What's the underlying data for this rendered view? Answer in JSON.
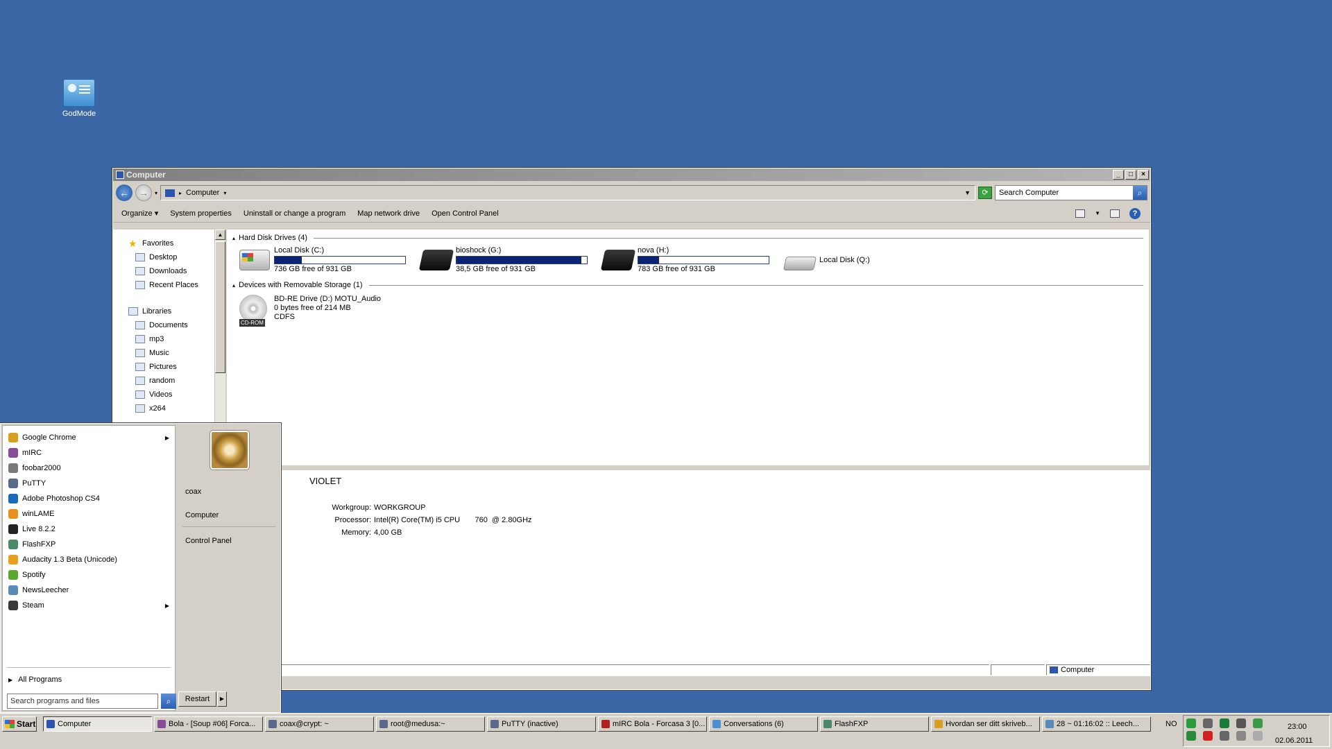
{
  "desktop": {
    "icons": [
      {
        "label": "GodMode"
      }
    ]
  },
  "window": {
    "title": "Computer",
    "address": "Computer",
    "search_placeholder": "Search Computer",
    "commands": [
      "Organize",
      "System properties",
      "Uninstall or change a program",
      "Map network drive",
      "Open Control Panel"
    ],
    "nav": {
      "favorites": {
        "label": "Favorites",
        "items": [
          "Desktop",
          "Downloads",
          "Recent Places"
        ]
      },
      "libraries": {
        "label": "Libraries",
        "items": [
          "Documents",
          "mp3",
          "Music",
          "Pictures",
          "random",
          "Videos",
          "x264"
        ]
      }
    },
    "hdd_section": "Hard Disk Drives (4)",
    "drives": [
      {
        "name": "Local Disk (C:)",
        "free": "736 GB free of 931 GB",
        "used_fraction": 0.21,
        "icon": "windows-drive-icon"
      },
      {
        "name": "bioshock (G:)",
        "free": "38,5 GB free of 931 GB",
        "used_fraction": 0.96,
        "icon": "external-drive-icon"
      },
      {
        "name": "nova (H:)",
        "free": "783 GB free of 931 GB",
        "used_fraction": 0.16,
        "icon": "external-drive-icon"
      },
      {
        "name": "Local Disk (Q:)",
        "icon": "disk-drive-icon"
      }
    ],
    "removable_section": "Devices with Removable Storage (1)",
    "removable": {
      "name": "BD-RE Drive (D:) MOTU_Audio",
      "free": "0 bytes free of 214 MB",
      "fs": "CDFS",
      "badge": "CD-ROM"
    },
    "details": {
      "computer_name": "VIOLET",
      "workgroup_label": "Workgroup:",
      "workgroup": "WORKGROUP",
      "processor_label": "Processor:",
      "processor": "Intel(R) Core(TM) i5 CPU       760  @ 2.80GHz",
      "memory_label": "Memory:",
      "memory": "4,00 GB"
    },
    "status": "Computer"
  },
  "start_menu": {
    "programs": [
      {
        "label": "Google Chrome",
        "color": "#d8a020",
        "submenu": true
      },
      {
        "label": "mIRC",
        "color": "#8a4a9a"
      },
      {
        "label": "foobar2000",
        "color": "#7a7a7a"
      },
      {
        "label": "PuTTY",
        "color": "#5a6a8a"
      },
      {
        "label": "Adobe Photoshop CS4",
        "color": "#1a6ab8"
      },
      {
        "label": "winLAME",
        "color": "#e89020"
      },
      {
        "label": "Live 8.2.2",
        "color": "#222222"
      },
      {
        "label": "FlashFXP",
        "color": "#4a8a6a"
      },
      {
        "label": "Audacity 1.3 Beta (Unicode)",
        "color": "#e8a020"
      },
      {
        "label": "Spotify",
        "color": "#5aa830"
      },
      {
        "label": "NewsLeecher",
        "color": "#5a8ab8"
      },
      {
        "label": "Steam",
        "color": "#3a3a3a",
        "submenu": true
      }
    ],
    "all_programs": "All Programs",
    "search_placeholder": "Search programs and files",
    "right_items": [
      "coax",
      "Computer",
      "Control Panel"
    ],
    "restart": "Restart"
  },
  "taskbar": {
    "start": "Start",
    "tasks": [
      {
        "label": "Computer",
        "color": "#2c55b0",
        "active": true
      },
      {
        "label": "Bola - [Soup #06] Forca...",
        "color": "#8a4a9a"
      },
      {
        "label": "coax@crypt: ~",
        "color": "#5a6a8a"
      },
      {
        "label": "root@medusa:~",
        "color": "#5a6a8a"
      },
      {
        "label": "PuTTY (inactive)",
        "color": "#5a6a8a"
      },
      {
        "label": "mIRC Bola - Forcasa 3 [0...",
        "color": "#b02020"
      },
      {
        "label": "Conversations (6)",
        "color": "#4a90d0"
      },
      {
        "label": "FlashFXP",
        "color": "#4a8a6a"
      },
      {
        "label": "Hvordan ser ditt skriveb...",
        "color": "#d8a020"
      },
      {
        "label": "28 ~ 01:16:02  ::  Leech...",
        "color": "#5a8ab8"
      }
    ],
    "lang": "NO",
    "tray_colors": [
      "#2a9a3a",
      "#666666",
      "#1a7a3a",
      "#555555",
      "#3a9a4a",
      "#2a8a3a",
      "#d02020",
      "#666666",
      "#888888",
      "#aaaaaa"
    ],
    "time": "23:00",
    "date": "02.06.2011"
  }
}
